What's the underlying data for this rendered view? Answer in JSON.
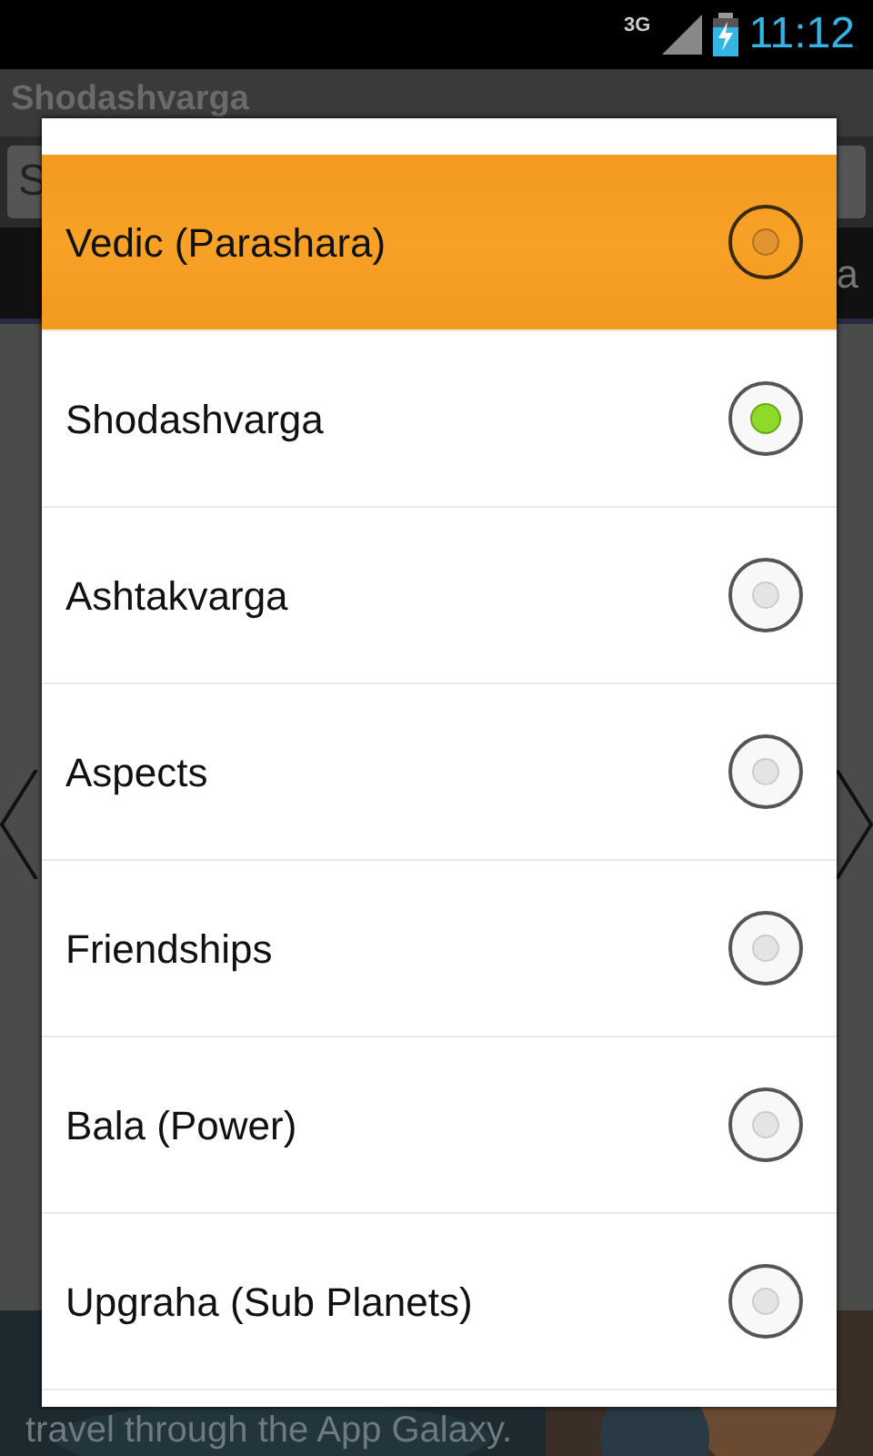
{
  "status_bar": {
    "network": "3G",
    "time": "11:12"
  },
  "background": {
    "title": "Shodashvarga",
    "spinner_value": "S",
    "tab_label": "a",
    "ad_lines": [
      "travel through the App Galaxy."
    ]
  },
  "dialog": {
    "items": [
      {
        "label": "Vedic (Parashara)",
        "selected": false,
        "highlighted": true
      },
      {
        "label": "Shodashvarga",
        "selected": true,
        "highlighted": false
      },
      {
        "label": "Ashtakvarga",
        "selected": false,
        "highlighted": false
      },
      {
        "label": "Aspects",
        "selected": false,
        "highlighted": false
      },
      {
        "label": "Friendships",
        "selected": false,
        "highlighted": false
      },
      {
        "label": "Bala (Power)",
        "selected": false,
        "highlighted": false
      },
      {
        "label": "Upgraha (Sub Planets)",
        "selected": false,
        "highlighted": false
      }
    ]
  }
}
